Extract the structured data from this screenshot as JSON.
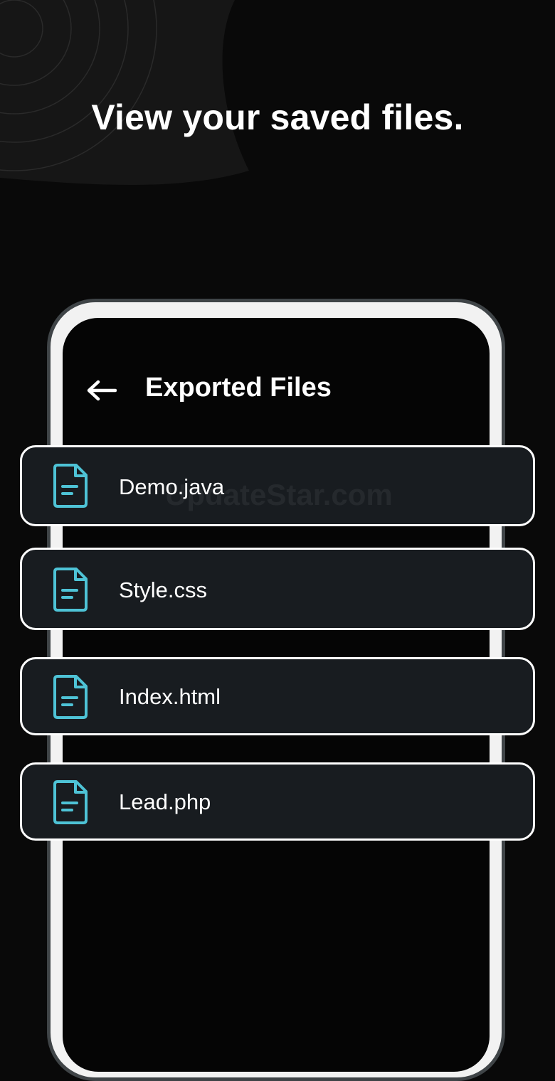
{
  "headline": "View your saved files.",
  "header": {
    "back_icon": "arrow-left-icon",
    "title": "Exported Files"
  },
  "files": [
    {
      "name": "Demo.java",
      "icon": "document-icon"
    },
    {
      "name": "Style.css",
      "icon": "document-icon"
    },
    {
      "name": "Index.html",
      "icon": "document-icon"
    },
    {
      "name": "Lead.php",
      "icon": "document-icon"
    }
  ],
  "watermark": "UpdateStar.com",
  "colors": {
    "background": "#090909",
    "card_background": "#181c20",
    "card_border": "#ffffff",
    "icon_accent": "#4ec3d6",
    "text": "#ffffff"
  }
}
